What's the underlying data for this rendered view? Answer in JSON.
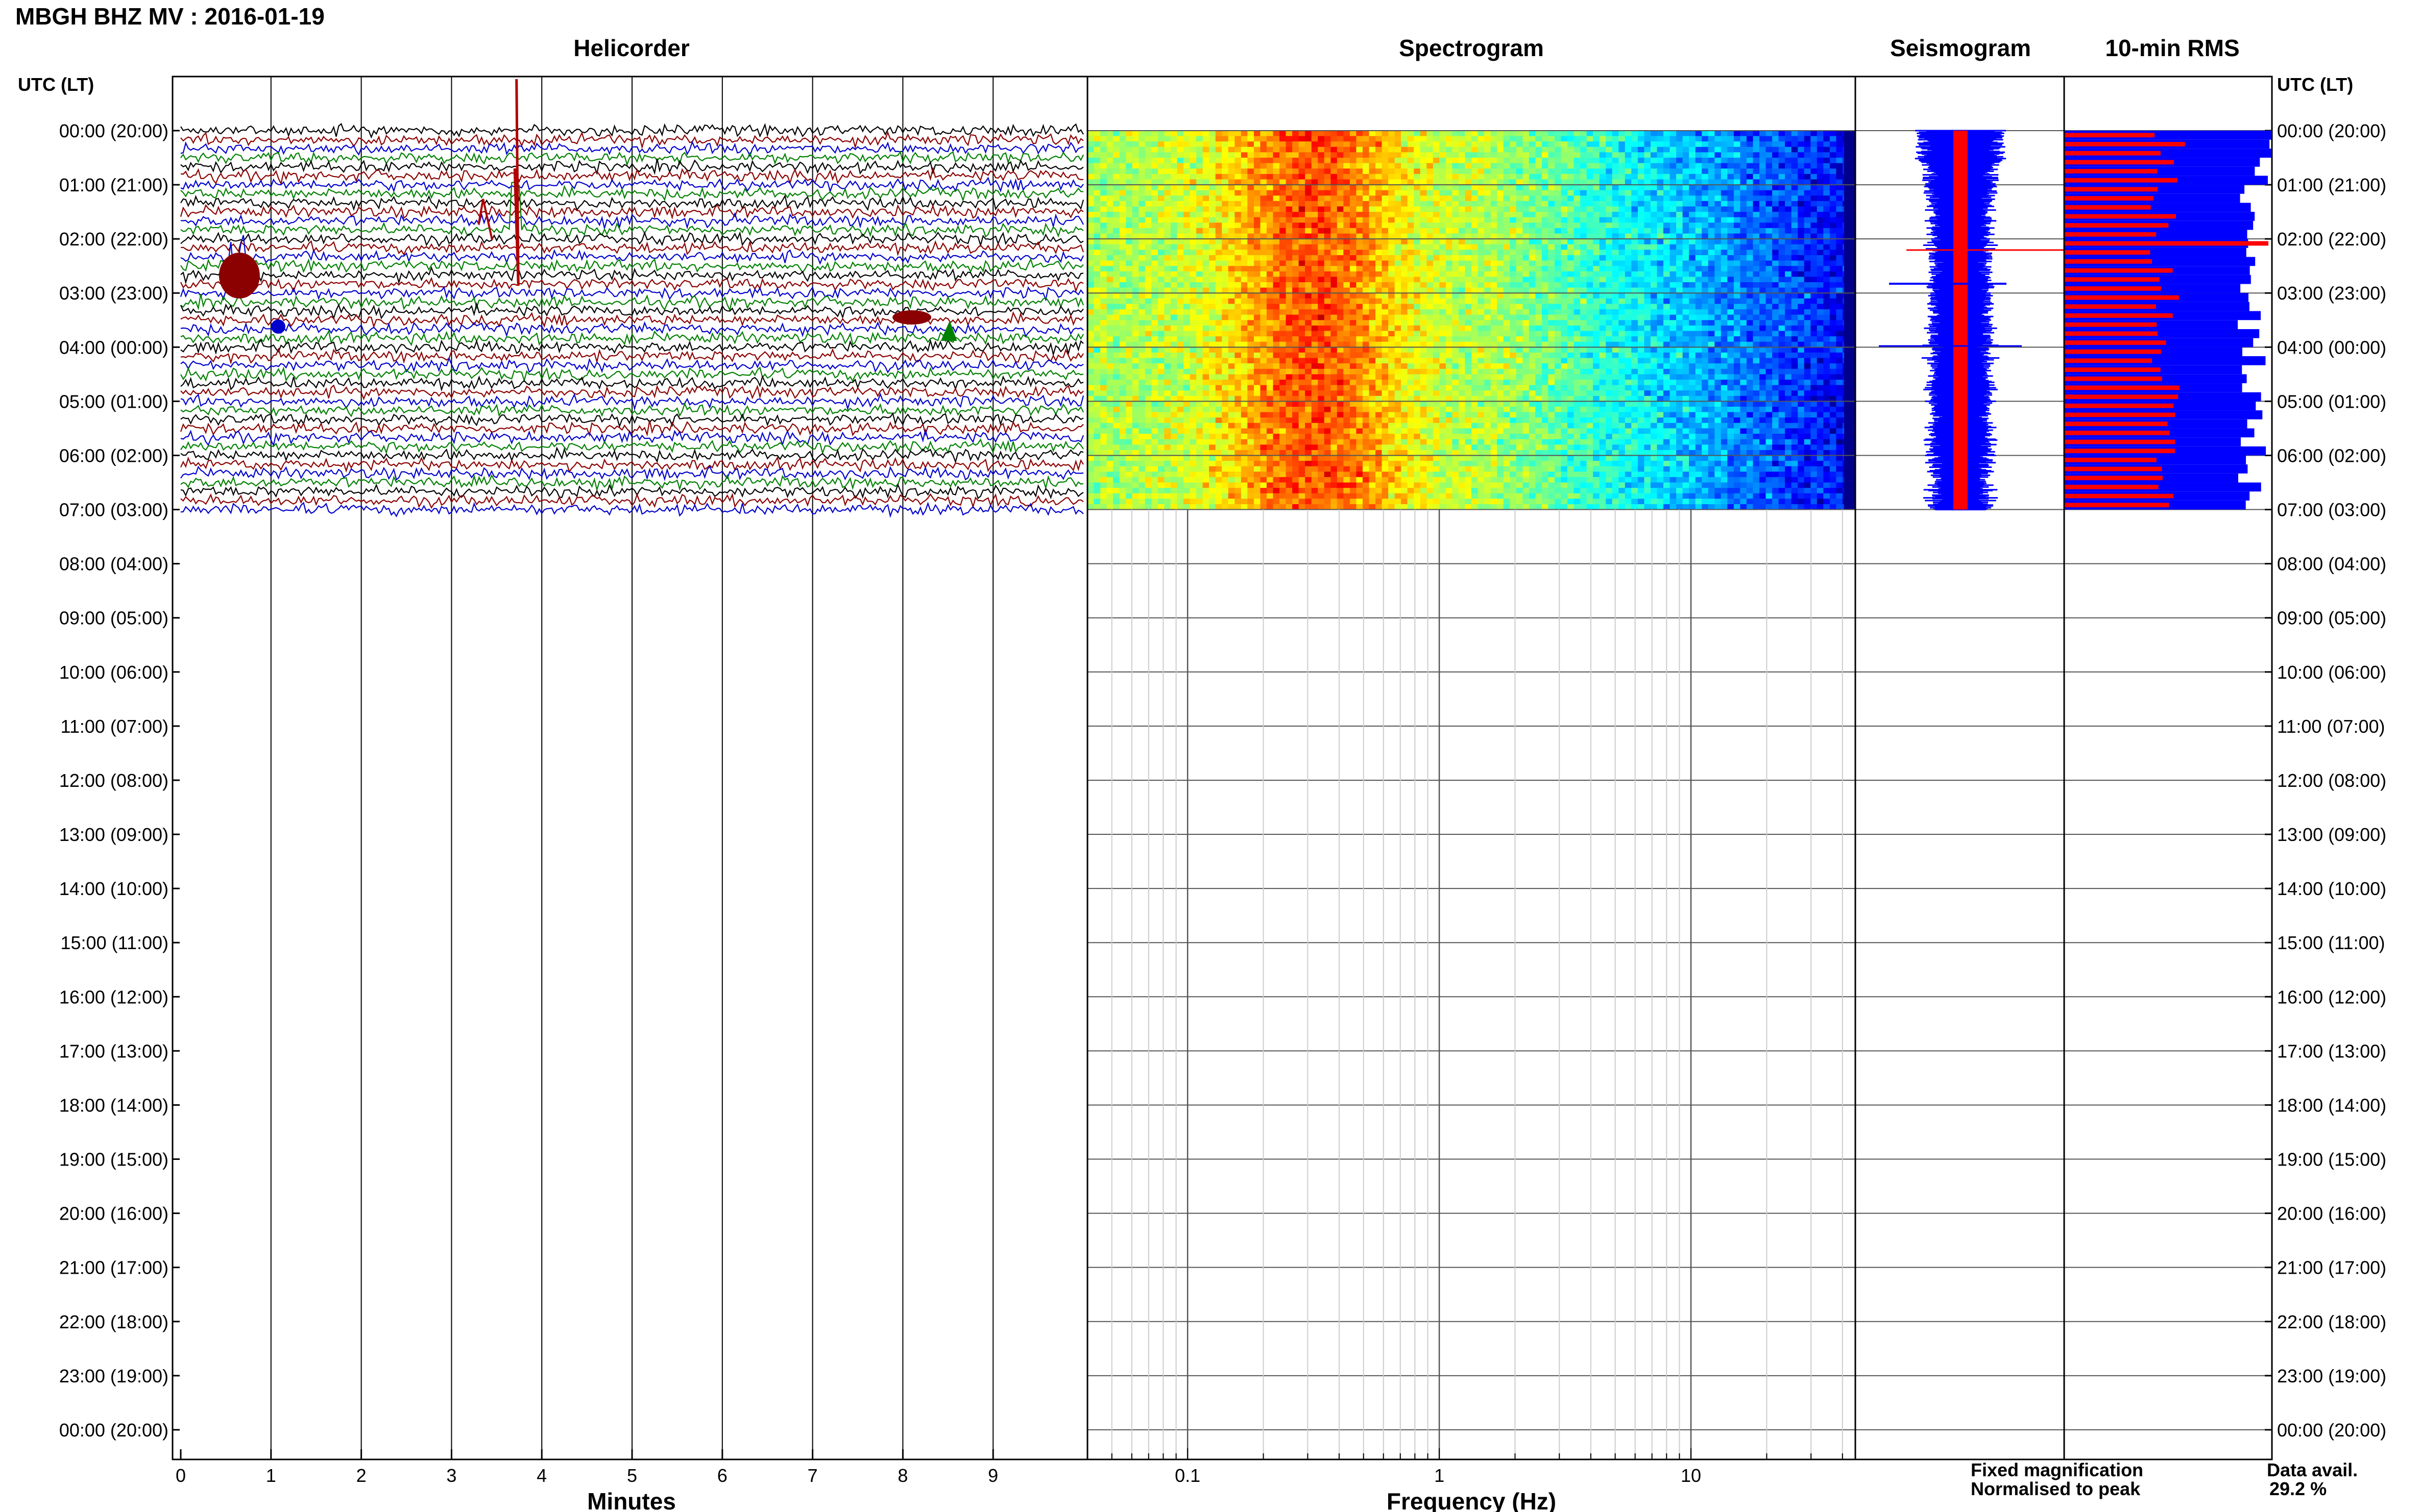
{
  "title": "MBGH BHZ MV : 2016-01-19",
  "panels": {
    "helicorder": "Helicorder",
    "spectrogram": "Spectrogram",
    "seismogram": "Seismogram",
    "rms": "10-min RMS"
  },
  "time_axis_label": "UTC (LT)",
  "time_labels": [
    "00:00 (20:00)",
    "01:00 (21:00)",
    "02:00 (22:00)",
    "03:00 (23:00)",
    "04:00 (00:00)",
    "05:00 (01:00)",
    "06:00 (02:00)",
    "07:00 (03:00)",
    "08:00 (04:00)",
    "09:00 (05:00)",
    "10:00 (06:00)",
    "11:00 (07:00)",
    "12:00 (08:00)",
    "13:00 (09:00)",
    "14:00 (10:00)",
    "15:00 (11:00)",
    "16:00 (12:00)",
    "17:00 (13:00)",
    "18:00 (14:00)",
    "19:00 (15:00)",
    "20:00 (16:00)",
    "21:00 (17:00)",
    "22:00 (18:00)",
    "23:00 (19:00)",
    "00:00 (20:00)"
  ],
  "minutes_ticks": [
    "0",
    "1",
    "2",
    "3",
    "4",
    "5",
    "6",
    "7",
    "8",
    "9"
  ],
  "minutes_label": "Minutes",
  "freq_ticks": [
    "0.1",
    "1",
    "10"
  ],
  "freq_label": "Frequency (Hz)",
  "legend": {
    "fixed": "Fixed magnification",
    "normalised": "Normalised to peak",
    "fixed_color": "#0000ff",
    "normalised_color": "#ff0000"
  },
  "availability": {
    "label": "Data avail.",
    "value": "29.2 %"
  },
  "chart_data": {
    "type": "line",
    "data_hours": 7,
    "helicorder": {
      "xlim": [
        0,
        10
      ],
      "trace_colors": [
        "#000000",
        "#8b0000",
        "#0000cd",
        "#008000"
      ],
      "events_minute": [
        0.65,
        3.7,
        8.1,
        8.5
      ]
    },
    "spectrogram": {
      "xlim_hz": [
        0.04,
        45
      ],
      "xscale": "log"
    },
    "rms": {
      "fixed_color": "#0000ff",
      "normalised_color": "#ff0000"
    }
  }
}
